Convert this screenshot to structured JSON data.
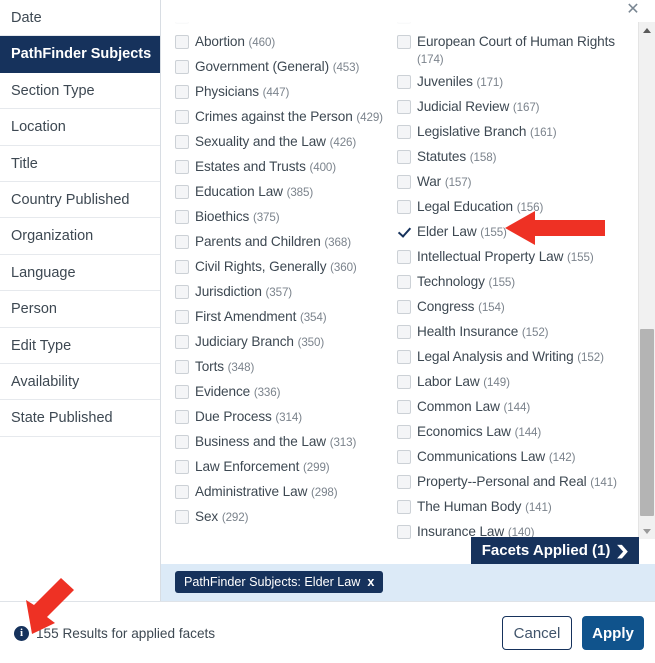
{
  "sidebar": {
    "items": [
      {
        "label": "Date",
        "selected": false
      },
      {
        "label": "PathFinder Subjects",
        "selected": true
      },
      {
        "label": "Section Type",
        "selected": false
      },
      {
        "label": "Location",
        "selected": false
      },
      {
        "label": "Title",
        "selected": false
      },
      {
        "label": "Country Published",
        "selected": false
      },
      {
        "label": "Organization",
        "selected": false
      },
      {
        "label": "Language",
        "selected": false
      },
      {
        "label": "Person",
        "selected": false
      },
      {
        "label": "Edit Type",
        "selected": false
      },
      {
        "label": "Availability",
        "selected": false
      },
      {
        "label": "State Published",
        "selected": false
      }
    ]
  },
  "dialog": {
    "close_icon": "✕"
  },
  "facets": {
    "left_column": [
      {
        "label": "",
        "count": "",
        "checked": false,
        "partial": true
      },
      {
        "label": "Abortion",
        "count": "(460)",
        "checked": false
      },
      {
        "label": "Government (General)",
        "count": "(453)",
        "checked": false
      },
      {
        "label": "Physicians",
        "count": "(447)",
        "checked": false
      },
      {
        "label": "Crimes against the Person",
        "count": "(429)",
        "checked": false
      },
      {
        "label": "Sexuality and the Law",
        "count": "(426)",
        "checked": false
      },
      {
        "label": "Estates and Trusts",
        "count": "(400)",
        "checked": false
      },
      {
        "label": "Education Law",
        "count": "(385)",
        "checked": false
      },
      {
        "label": "Bioethics",
        "count": "(375)",
        "checked": false
      },
      {
        "label": "Parents and Children",
        "count": "(368)",
        "checked": false
      },
      {
        "label": "Civil Rights, Generally",
        "count": "(360)",
        "checked": false
      },
      {
        "label": "Jurisdiction",
        "count": "(357)",
        "checked": false
      },
      {
        "label": "First Amendment",
        "count": "(354)",
        "checked": false
      },
      {
        "label": "Judiciary Branch",
        "count": "(350)",
        "checked": false
      },
      {
        "label": "Torts",
        "count": "(348)",
        "checked": false
      },
      {
        "label": "Evidence",
        "count": "(336)",
        "checked": false
      },
      {
        "label": "Due Process",
        "count": "(314)",
        "checked": false
      },
      {
        "label": "Business and the Law",
        "count": "(313)",
        "checked": false
      },
      {
        "label": "Law Enforcement",
        "count": "(299)",
        "checked": false
      },
      {
        "label": "Administrative Law",
        "count": "(298)",
        "checked": false
      },
      {
        "label": "Sex",
        "count": "(292)",
        "checked": false
      }
    ],
    "right_column": [
      {
        "label": "",
        "count": "",
        "checked": false,
        "partial": true
      },
      {
        "label": "European Court of Human Rights",
        "count": "(174)",
        "checked": false
      },
      {
        "label": "Juveniles",
        "count": "(171)",
        "checked": false
      },
      {
        "label": "Judicial Review",
        "count": "(167)",
        "checked": false
      },
      {
        "label": "Legislative Branch",
        "count": "(161)",
        "checked": false
      },
      {
        "label": "Statutes",
        "count": "(158)",
        "checked": false
      },
      {
        "label": "War",
        "count": "(157)",
        "checked": false
      },
      {
        "label": "Legal Education",
        "count": "(156)",
        "checked": false
      },
      {
        "label": "Elder Law",
        "count": "(155)",
        "checked": true
      },
      {
        "label": "Intellectual Property Law",
        "count": "(155)",
        "checked": false
      },
      {
        "label": "Technology",
        "count": "(155)",
        "checked": false
      },
      {
        "label": "Congress",
        "count": "(154)",
        "checked": false
      },
      {
        "label": "Health Insurance",
        "count": "(152)",
        "checked": false
      },
      {
        "label": "Legal Analysis and Writing",
        "count": "(152)",
        "checked": false
      },
      {
        "label": "Labor Law",
        "count": "(149)",
        "checked": false
      },
      {
        "label": "Common Law",
        "count": "(144)",
        "checked": false
      },
      {
        "label": "Economics Law",
        "count": "(144)",
        "checked": false
      },
      {
        "label": "Communications Law",
        "count": "(142)",
        "checked": false
      },
      {
        "label": "Property--Personal and Real",
        "count": "(141)",
        "checked": false
      },
      {
        "label": "The Human Body",
        "count": "(141)",
        "checked": false
      },
      {
        "label": "Insurance Law",
        "count": "(140)",
        "checked": false
      }
    ]
  },
  "facets_applied": {
    "label": "Facets Applied (1)",
    "caret": "❯"
  },
  "applied_chip": {
    "label": "PathFinder Subjects: Elder Law",
    "remove": "x"
  },
  "footer": {
    "info_glyph": "i",
    "results_text": "155 Results for applied facets",
    "cancel_label": "Cancel",
    "apply_label": "Apply"
  },
  "colors": {
    "navy": "#16325c",
    "apply_blue": "#10538c",
    "chip_strip": "#dceaf7",
    "annotation_red": "#ee3124"
  }
}
